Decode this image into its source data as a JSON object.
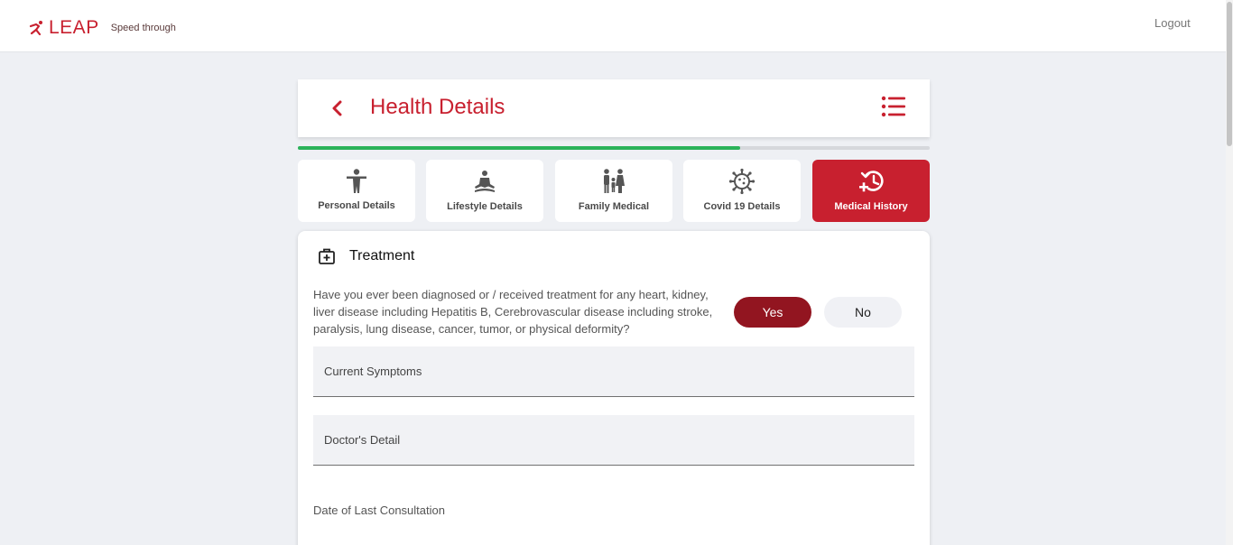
{
  "brand": {
    "name": "LEAP",
    "tagline": "Speed through",
    "color": "#c8202f"
  },
  "topbar": {
    "logout_label": "Logout"
  },
  "header": {
    "title": "Health Details",
    "back_icon": "chevron-left-icon",
    "menu_icon": "list-menu-icon"
  },
  "progress": {
    "percent": 70,
    "color": "#2bb35a"
  },
  "tabs": [
    {
      "label": "Personal Details",
      "icon": "person-icon",
      "active": false
    },
    {
      "label": "Lifestyle Details",
      "icon": "meditation-icon",
      "active": false
    },
    {
      "label": "Family Medical",
      "icon": "family-icon",
      "active": false
    },
    {
      "label": "Covid 19 Details",
      "icon": "virus-icon",
      "active": false
    },
    {
      "label": "Medical History",
      "icon": "history-plus-icon",
      "active": true
    }
  ],
  "treatment": {
    "title": "Treatment",
    "icon": "medical-kit-icon",
    "question": "Have you ever been diagnosed or / received treatment for any heart, kidney, liver disease including Hepatitis B, Cerebrovascular disease including stroke, paralysis, lung disease, cancer, tumor, or physical deformity?",
    "yes_label": "Yes",
    "no_label": "No",
    "selected": "Yes",
    "symptoms_placeholder": "Current Symptoms",
    "doctor_placeholder": "Doctor's Detail",
    "date_label": "Date of Last Consultation"
  },
  "colors": {
    "accent": "#c8202f",
    "selected_button": "#921520",
    "page_bg": "#eef0f4"
  }
}
